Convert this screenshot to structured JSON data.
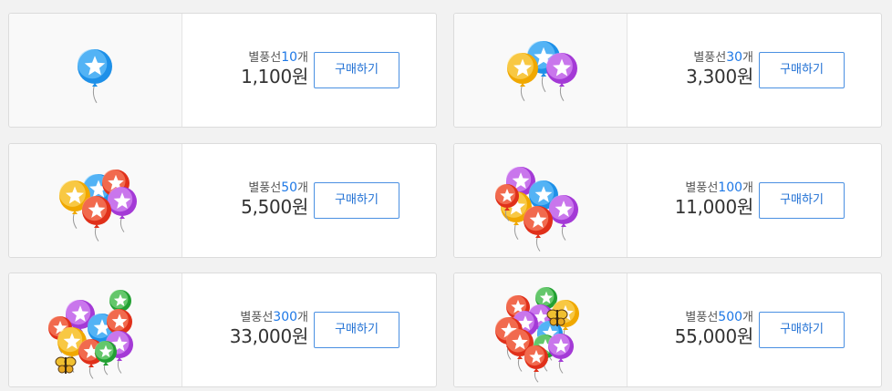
{
  "accent_color": "#1e78e6",
  "button_border_color": "#4a90e2",
  "products": [
    {
      "prefix": "별풍선",
      "amount": "10",
      "suffix": "개",
      "price": "1,100원",
      "button": "구매하기",
      "icon": "balloon-star-icon"
    },
    {
      "prefix": "별풍선",
      "amount": "30",
      "suffix": "개",
      "price": "3,300원",
      "button": "구매하기",
      "icon": "balloon-cluster-icon"
    },
    {
      "prefix": "별풍선",
      "amount": "50",
      "suffix": "개",
      "price": "5,500원",
      "button": "구매하기",
      "icon": "balloon-cluster-icon"
    },
    {
      "prefix": "별풍선",
      "amount": "100",
      "suffix": "개",
      "price": "11,000원",
      "button": "구매하기",
      "icon": "balloon-cluster-icon"
    },
    {
      "prefix": "별풍선",
      "amount": "300",
      "suffix": "개",
      "price": "33,000원",
      "button": "구매하기",
      "icon": "balloon-cluster-icon"
    },
    {
      "prefix": "별풍선",
      "amount": "500",
      "suffix": "개",
      "price": "55,000원",
      "button": "구매하기",
      "icon": "balloon-cluster-icon"
    }
  ]
}
